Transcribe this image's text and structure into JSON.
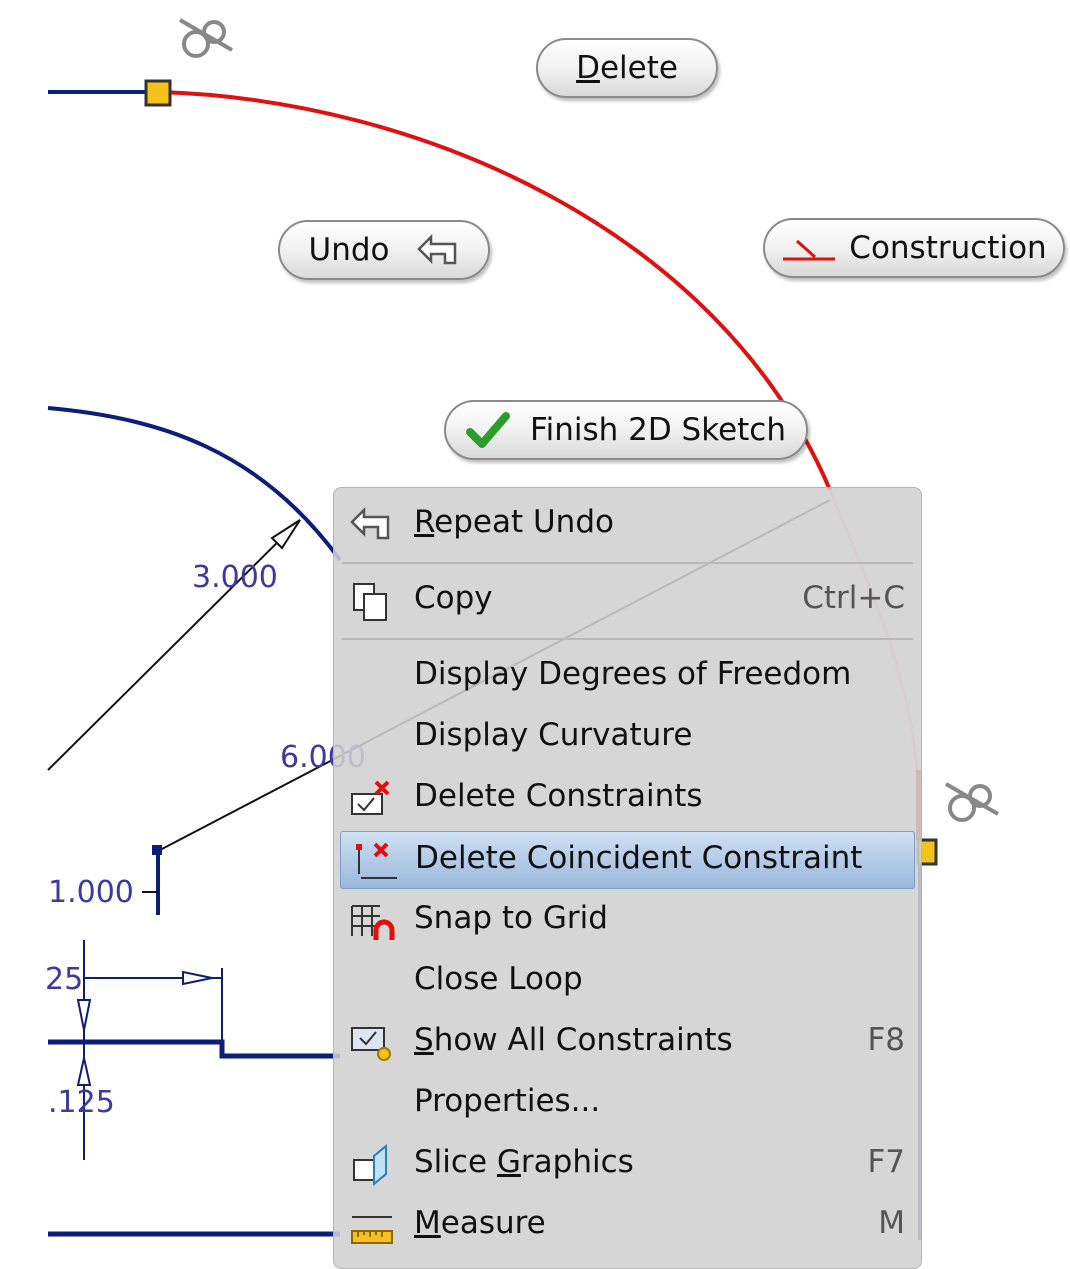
{
  "marking_menu": {
    "delete_label": "Delete",
    "undo_label": "Undo",
    "construction_label": "Construction",
    "finish_label": "Finish 2D Sketch"
  },
  "dimensions": {
    "radius": "3.000",
    "diameter": "6.000",
    "vertical": "1.000",
    "small_a": "25",
    "small_b": ".125"
  },
  "context_menu": {
    "items": [
      {
        "pre": "",
        "u": "R",
        "post": "epeat Undo",
        "shortcut": "",
        "icon": "repeat-undo-icon"
      },
      {
        "pre": "",
        "u": "",
        "post": "Copy",
        "shortcut": "Ctrl+C",
        "icon": "copy-icon"
      },
      {
        "pre": "",
        "u": "",
        "post": "Display Degrees of Freedom",
        "shortcut": "",
        "icon": ""
      },
      {
        "pre": "",
        "u": "",
        "post": "Display Curvature",
        "shortcut": "",
        "icon": ""
      },
      {
        "pre": "",
        "u": "",
        "post": "Delete Constraints",
        "shortcut": "",
        "icon": "delete-constraints-icon"
      },
      {
        "pre": "",
        "u": "",
        "post": "Delete Coincident Constraint",
        "shortcut": "",
        "icon": "delete-coincident-icon"
      },
      {
        "pre": "",
        "u": "",
        "post": "Snap to Grid",
        "shortcut": "",
        "icon": "snap-grid-icon"
      },
      {
        "pre": "",
        "u": "",
        "post": "Close Loop",
        "shortcut": "",
        "icon": ""
      },
      {
        "pre": "",
        "u": "S",
        "post": "how All Constraints",
        "shortcut": "F8",
        "icon": "show-constraints-icon"
      },
      {
        "pre": "",
        "u": "",
        "post": "Properties...",
        "shortcut": "",
        "icon": ""
      },
      {
        "pre": "Slice ",
        "u": "G",
        "post": "raphics",
        "shortcut": "F7",
        "icon": "slice-graphics-icon"
      },
      {
        "pre": "",
        "u": "M",
        "post": "easure",
        "shortcut": "M",
        "icon": "measure-icon"
      }
    ]
  },
  "colors": {
    "sketch_blue": "#0b1f7a",
    "selected_red": "#e01010",
    "highlight": "#a9c4e4"
  }
}
